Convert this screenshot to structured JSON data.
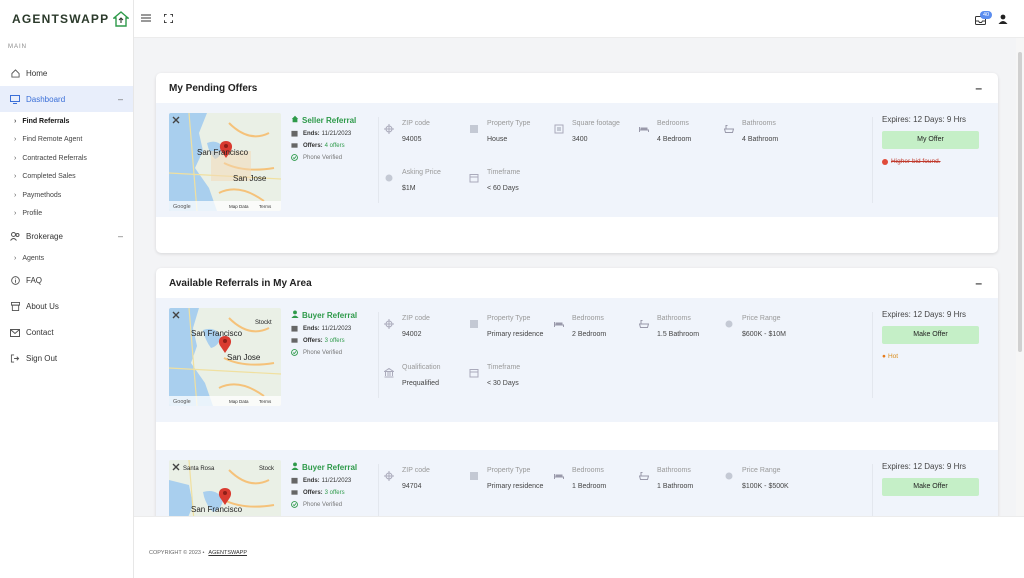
{
  "brand": {
    "name": "AGENTSWAPP",
    "color": "#2e9a4a"
  },
  "sidebar": {
    "section": "MAIN",
    "items": [
      {
        "label": "Home",
        "icon": "home-icon"
      },
      {
        "label": "Dashboard",
        "icon": "monitor-icon",
        "active": true
      },
      {
        "label": "Brokerage",
        "icon": "users-icon"
      },
      {
        "label": "FAQ",
        "icon": "info-icon"
      },
      {
        "label": "About Us",
        "icon": "archive-icon"
      },
      {
        "label": "Contact",
        "icon": "mail-icon"
      },
      {
        "label": "Sign Out",
        "icon": "sign-out-icon"
      }
    ],
    "dashboard_sub": [
      "Find Referrals",
      "Find Remote Agent",
      "Contracted Referrals",
      "Completed Sales",
      "Paymethods",
      "Profile"
    ],
    "brokerage_sub": [
      "Agents"
    ]
  },
  "topbar": {
    "notification_count": "40"
  },
  "pending": {
    "title": "My Pending Offers",
    "offer": {
      "type": "Seller Referral",
      "ends_label": "Ends:",
      "ends": "11/21/2023",
      "offers_label": "Offers:",
      "offers": "4 offers",
      "verified": "Phone Verified",
      "map_city1": "San Francisco",
      "map_city2": "San Jose",
      "fields": [
        {
          "label": "ZIP code",
          "value": "94005"
        },
        {
          "label": "Property Type",
          "value": "House"
        },
        {
          "label": "Square footage",
          "value": "3400"
        },
        {
          "label": "Bedrooms",
          "value": "4 Bedroom"
        },
        {
          "label": "Bathrooms",
          "value": "4 Bathroom"
        },
        {
          "label": "Asking Price",
          "value": "$1M"
        },
        {
          "label": "Timeframe",
          "value": "< 60 Days"
        }
      ],
      "expires": "Expires: 12 Days: 9 Hrs",
      "button": "My Offer",
      "note": "Higher bid found."
    }
  },
  "available": {
    "title": "Available Referrals in My Area",
    "referrals": [
      {
        "type": "Buyer Referral",
        "ends_label": "Ends:",
        "ends": "11/21/2023",
        "offers_label": "Offers:",
        "offers": "3 offers",
        "verified": "Phone Verified",
        "map_city1": "San Francisco",
        "map_city2": "San Jose",
        "map_city3": "Stockton",
        "fields": [
          {
            "label": "ZIP code",
            "value": "94002"
          },
          {
            "label": "Property Type",
            "value": "Primary residence"
          },
          {
            "label": "Bedrooms",
            "value": "2 Bedroom"
          },
          {
            "label": "Bathrooms",
            "value": "1.5 Bathroom"
          },
          {
            "label": "Price Range",
            "value": "$600K - $10M"
          },
          {
            "label": "Qualification",
            "value": "Prequalified"
          },
          {
            "label": "Timeframe",
            "value": "< 30 Days"
          }
        ],
        "expires": "Expires: 12 Days: 9 Hrs",
        "button": "Make Offer",
        "note": "Hot"
      },
      {
        "type": "Buyer Referral",
        "ends_label": "Ends:",
        "ends": "11/21/2023",
        "offers_label": "Offers:",
        "offers": "3 offers",
        "verified": "Phone Verified",
        "map_city1": "San Francisco",
        "map_city2": "Santa Rosa",
        "map_city3": "Stockton",
        "fields": [
          {
            "label": "ZIP code",
            "value": "94704"
          },
          {
            "label": "Property Type",
            "value": "Primary residence"
          },
          {
            "label": "Bedrooms",
            "value": "1 Bedroom"
          },
          {
            "label": "Bathrooms",
            "value": "1 Bathroom"
          },
          {
            "label": "Price Range",
            "value": "$100K - $500K"
          }
        ],
        "expires": "Expires: 12 Days: 9 Hrs",
        "button": "Make Offer"
      }
    ]
  },
  "footer": {
    "copyright": "COPYRIGHT © 2023 •",
    "brand": "AGENTSWAPP"
  }
}
